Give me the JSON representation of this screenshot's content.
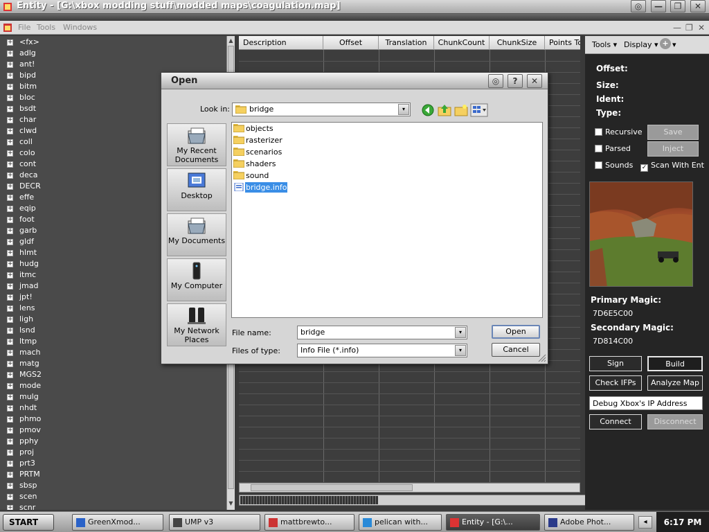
{
  "window": {
    "title": "Entity - [G:\\xbox modding stuff\\modded maps\\coagulation.map]",
    "controls": [
      "◎",
      "—",
      "❐",
      "✕"
    ]
  },
  "menubar": {
    "items": [
      "File",
      "Tools",
      "Windows"
    ],
    "window_controls": [
      "—",
      "❐",
      "✕"
    ]
  },
  "tree": {
    "expander": "+",
    "items": [
      "<fx>",
      "adlg",
      "ant!",
      "bipd",
      "bitm",
      "bloc",
      "bsdt",
      "char",
      "clwd",
      "coll",
      "colo",
      "cont",
      "deca",
      "DECR",
      "effe",
      "eqip",
      "foot",
      "garb",
      "gldf",
      "hlmt",
      "hudg",
      "itmc",
      "jmad",
      "jpt!",
      "lens",
      "ligh",
      "lsnd",
      "ltmp",
      "mach",
      "matg",
      "MGS2",
      "mode",
      "mulg",
      "nhdt",
      "phmo",
      "pmov",
      "pphy",
      "proj",
      "prt3",
      "PRTM",
      "sbsp",
      "scen",
      "scnr"
    ]
  },
  "grid": {
    "columns": [
      "Description",
      "Offset",
      "Translation",
      "ChunkCount",
      "ChunkSize",
      "Points To"
    ]
  },
  "progress": {
    "fraction": 0.3
  },
  "right_toolbar": {
    "tools_label": "Tools",
    "display_label": "Display",
    "dropdown_glyph": "▾",
    "add_glyph": "+"
  },
  "right_panel": {
    "offset_label": "Offset:",
    "size_label": "Size:",
    "ident_label": "Ident:",
    "type_label": "Type:",
    "recursive_label": "Recursive",
    "parsed_label": "Parsed",
    "sounds_label": "Sounds",
    "scan_label": "Scan With Ent",
    "scan_check": "✓",
    "save_label": "Save",
    "inject_label": "Inject",
    "primary_magic_label": "Primary Magic:",
    "primary_magic_value": "7D6E5C00",
    "secondary_magic_label": "Secondary Magic:",
    "secondary_magic_value": "7D814C00",
    "sign_label": "Sign",
    "build_label": "Build",
    "check_ifps_label": "Check IFPs",
    "analyze_map_label": "Analyze Map",
    "ip_value": "Debug  Xbox's  IP  Address",
    "connect_label": "Connect",
    "disconnect_label": "Disconnect"
  },
  "dialog": {
    "title": "Open",
    "controls": [
      "◎",
      "?",
      "✕"
    ],
    "look_in_label": "Look in:",
    "look_in_value": "bridge",
    "dropdown_glyph": "▾",
    "places": [
      {
        "label": "My Recent Documents"
      },
      {
        "label": "Desktop"
      },
      {
        "label": "My Documents"
      },
      {
        "label": "My Computer"
      },
      {
        "label": "My Network Places"
      }
    ],
    "files": [
      {
        "name": "objects",
        "type": "folder"
      },
      {
        "name": "rasterizer",
        "type": "folder"
      },
      {
        "name": "scenarios",
        "type": "folder"
      },
      {
        "name": "shaders",
        "type": "folder"
      },
      {
        "name": "sound",
        "type": "folder"
      },
      {
        "name": "bridge.info",
        "type": "file",
        "selected": true
      }
    ],
    "file_name_label": "File name:",
    "file_name_value": "bridge",
    "files_of_type_label": "Files of type:",
    "files_of_type_value": "Info File (*.info)",
    "open_label": "Open",
    "cancel_label": "Cancel"
  },
  "taskbar": {
    "start_label": "START",
    "tasks": [
      {
        "label": "GreenXmod..."
      },
      {
        "label": "UMP v3"
      },
      {
        "label": "mattbrewto..."
      },
      {
        "label": "pelican with..."
      },
      {
        "label": "Entity - [G:\\...",
        "active": true
      },
      {
        "label": "Adobe Phot..."
      }
    ],
    "tray_arrow": "◂",
    "clock": "6:17 PM"
  }
}
